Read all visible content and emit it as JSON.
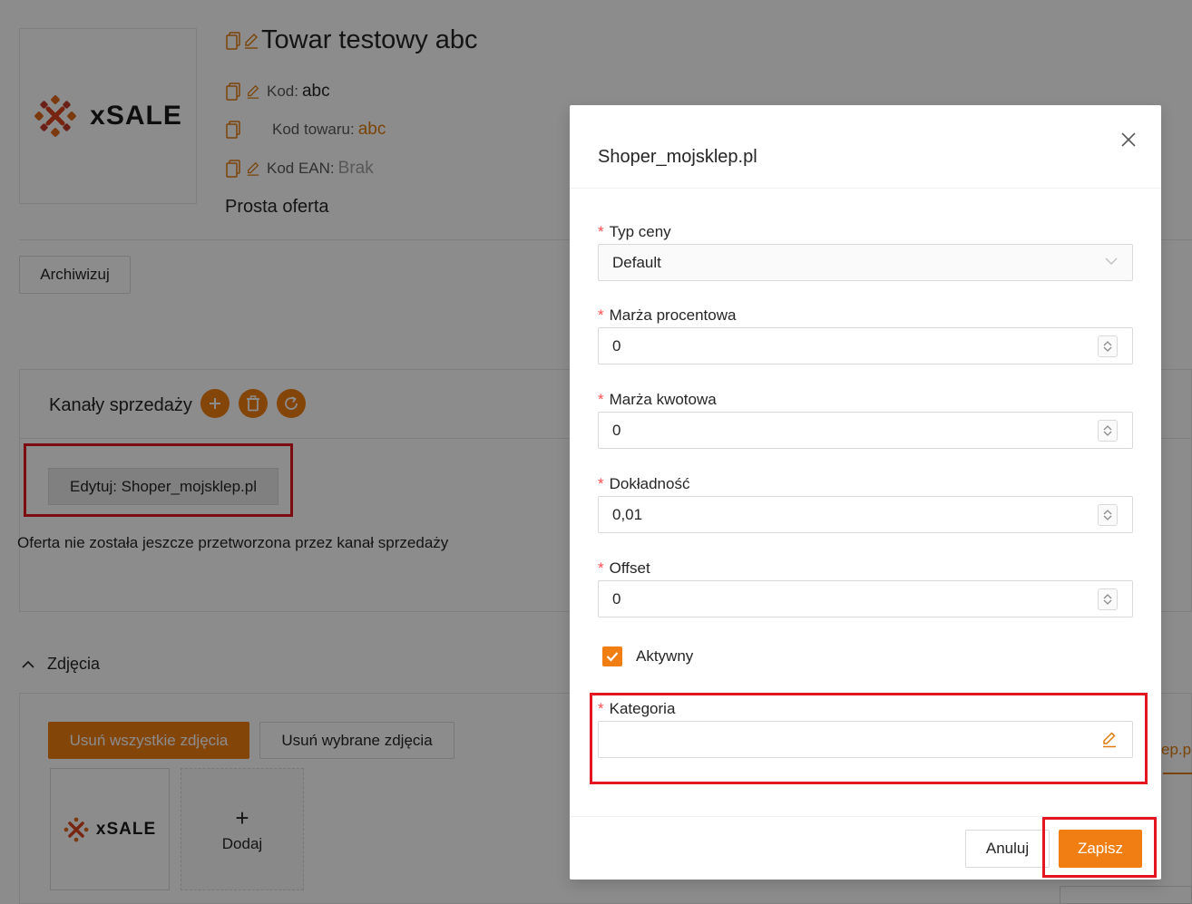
{
  "product": {
    "title": "Towar testowy abc",
    "code_label": "Kod:",
    "code_value": "abc",
    "product_code_label": "Kod towaru:",
    "product_code_value": "abc",
    "ean_label": "Kod EAN:",
    "ean_value": "Brak",
    "offer_type": "Prosta oferta",
    "logo_text": "xSALE"
  },
  "actions": {
    "archive_label": "Archiwizuj"
  },
  "channels": {
    "title": "Kanały sprzedaży",
    "edit_button_label": "Edytuj: Shoper_mojsklep.pl",
    "status_text": "Oferta nie została jeszcze przetworzona przez kanał sprzedaży"
  },
  "photos": {
    "title": "Zdjęcia",
    "delete_all_label": "Usuń wszystkie zdjęcia",
    "delete_selected_label": "Usuń wybrane zdjęcia",
    "add_label": "Dodaj",
    "add_symbol": "+",
    "peek_tab_label": "ep.pl"
  },
  "modal": {
    "title": "Shoper_mojsklep.pl",
    "fields": {
      "price_type": {
        "label": "Typ ceny",
        "value": "Default"
      },
      "margin_percent": {
        "label": "Marża procentowa",
        "value": "0"
      },
      "margin_amount": {
        "label": "Marża kwotowa",
        "value": "0"
      },
      "precision": {
        "label": "Dokładność",
        "value": "0,01"
      },
      "offset": {
        "label": "Offset",
        "value": "0"
      },
      "active": {
        "label": "Aktywny",
        "checked": true
      },
      "category": {
        "label": "Kategoria",
        "value": ""
      }
    },
    "required_mark": "*",
    "cancel_label": "Anuluj",
    "save_label": "Zapisz"
  },
  "colors": {
    "accent": "#f07e12",
    "highlight_frame": "#e3161f",
    "required": "#ff4d4f"
  }
}
